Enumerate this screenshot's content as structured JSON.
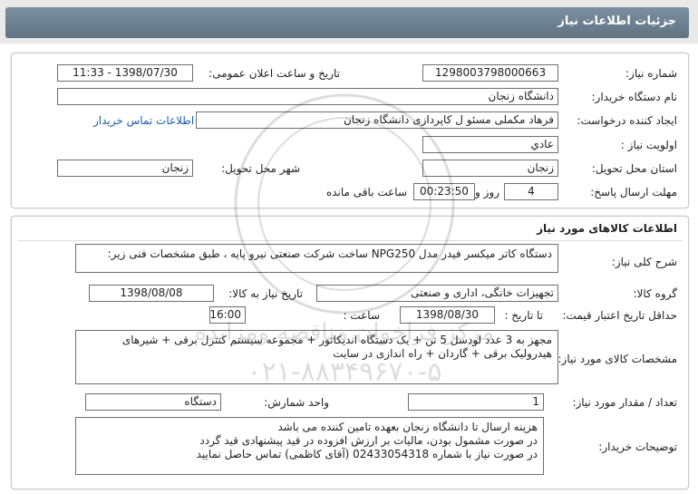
{
  "header": {
    "title": "جزئیات اطلاعات نیاز"
  },
  "info": {
    "need_number_label": "شماره نیاز:",
    "need_number": "1298003798000663",
    "announce_label": "تاریخ و ساعت اعلان عمومی:",
    "announce_value": "1398/07/30 - 11:33",
    "buyer_label": "نام دستگاه خریدار:",
    "buyer_value": "دانشگاه زنجان",
    "creator_label": "ایجاد کننده درخواست:",
    "creator_value": "فرهاد مکملی مسئو ل کاپردازی دانشگاه زنجان",
    "contact_link": "اطلاعات تماس خریدار",
    "priority_label": "اولویت نیاز :",
    "priority_value": "عادي",
    "province_label": "استان محل تحویل:",
    "province_value": "زنجان",
    "city_label": "شهر محل تحویل:",
    "city_value": "زنجان",
    "deadline_label": "مهلت ارسال پاسخ:",
    "days_value": "4",
    "days_label": "روز و",
    "time_value": "00:23:50",
    "remaining_label": "ساعت باقی مانده"
  },
  "goods": {
    "section_title": "اطلاعات کالاهای مورد نیاز",
    "general_desc_label": "شرح کلی نیاز:",
    "general_desc_value": "دستگاه کاتر میکسر فیدر مدل NPG250 ساخت شرکت صنعتی نیرو پایه ، طبق مشخصات فنی زیر:",
    "group_label": "گروه کالا:",
    "group_value": "تجهیزات خانگی، اداری و صنعتی",
    "need_date_label": "تاریخ نیاز به کالا:",
    "need_date_value": "1398/08/08",
    "min_validity_label": "حداقل تاریخ اعتبار قیمت:",
    "until_date_label": "تا تاریخ :",
    "until_date_value": "1398/08/30",
    "hour_label": "ساعت :",
    "hour_value": "16:00",
    "specs_label": "مشخصات کالای مورد نیاز:",
    "specs_value": "مجهز به 3 عدد لودسل 5 تن + یک دستگاه اندیکاتور + مجموعه سیستم کنترل برقی + شیرهای هیدرولیک برقی + گاردان + راه اندازی در سایت",
    "qty_label": "تعداد / مقدار مورد نیاز:",
    "qty_value": "1",
    "unit_label": "واحد شمارش:",
    "unit_value": "دستگاه",
    "buyer_notes_label": "توضیحات خریدار:",
    "buyer_notes_lines": [
      "هزینه ارسال تا دانشگاه زنجان بعهده تامین کننده می باشد",
      "در صورت مشمول بودن، مالیات بر ارزش افزوده در قید پیشنهادی قید گردد",
      "در صورت نیاز با شماره 02433054318 (آقای کاظمی) تماس حاصل نمایید"
    ]
  },
  "watermark": {
    "line1": "مرکز فراخوان مناقصه ومزایده",
    "line2": "۰۲۱-۸۸۳۴۹۶۷۰-۵"
  }
}
